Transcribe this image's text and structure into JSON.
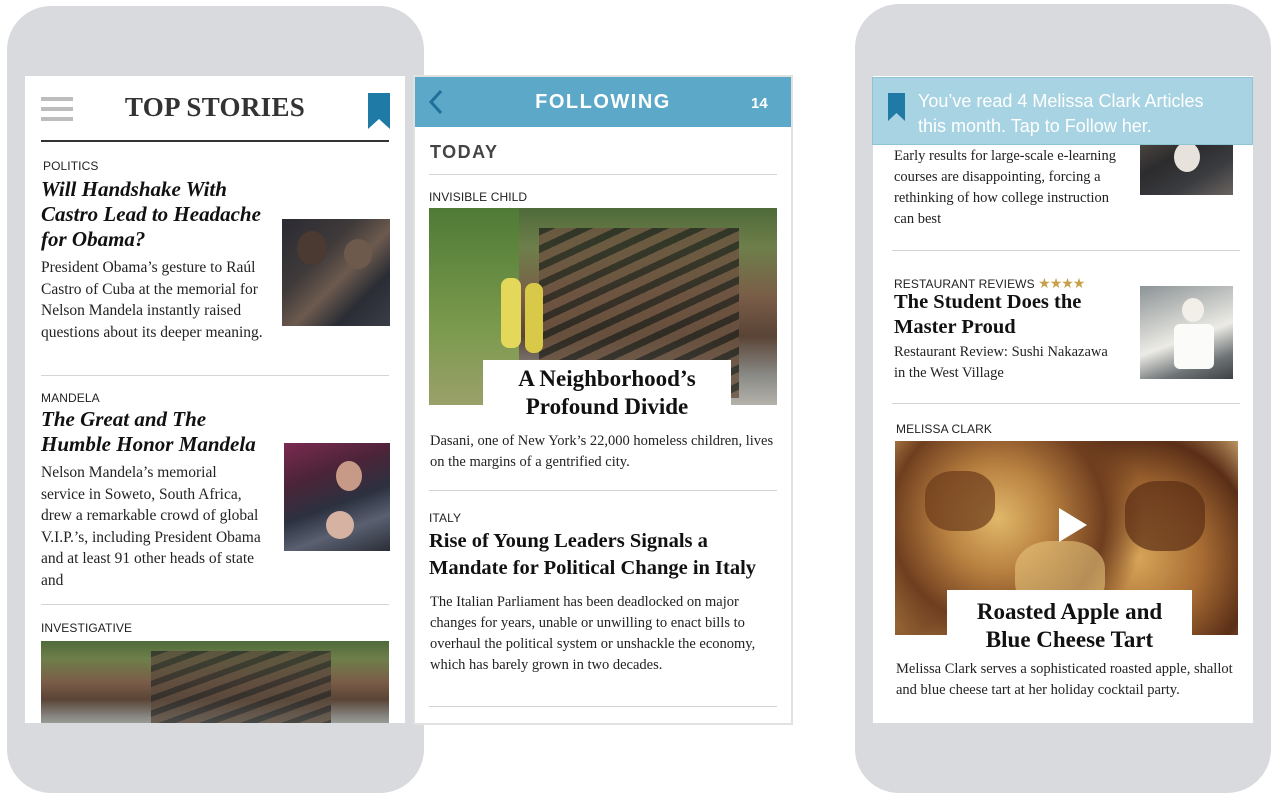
{
  "left_phone": {
    "header": {
      "title": "TOP STORIES",
      "menu_icon": "hamburger-menu-icon",
      "bookmark_icon": "bookmark-icon"
    },
    "stories": [
      {
        "section": "POLITICS",
        "headline": "Will Handshake With Castro Lead to Headache for Obama?",
        "summary": "President Obama’s gesture to Raúl Castro of Cuba at the memorial for Nelson Mandela instantly raised questions about its deeper meaning."
      },
      {
        "section": "MANDELA",
        "headline": "The Great and The Humble Honor Mandela",
        "summary": "Nelson Mandela’s memorial service in Soweto, South Africa, drew a remarkable crowd of global V.I.P.’s, including President Obama and at least 91 other heads of state and"
      },
      {
        "section": "INVESTIGATIVE"
      }
    ]
  },
  "middle_phone": {
    "header": {
      "back_icon": "chevron-left-icon",
      "title": "FOLLOWING",
      "count": "14",
      "bar_color": "#5ba8c8"
    },
    "date_heading": "TODAY",
    "stories": [
      {
        "section": "INVISIBLE CHILD",
        "headline_line1": "A Neighborhood’s",
        "headline_line2": "Profound Divide",
        "summary": "Dasani, one of New York’s 22,000 homeless children, lives on the margins of a gentrified city."
      },
      {
        "section": "ITALY",
        "headline": "Rise of Young Leaders Signals a Mandate for Political Change in Italy",
        "summary": "The Italian Parliament has been deadlocked on major changes for years, unable or unwilling to enact bills to overhaul the political system or unshackle the economy, which has barely grown in two decades."
      }
    ]
  },
  "right_phone": {
    "notification": {
      "icon": "bookmark-icon",
      "text_line1": "You’ve read 4 Melissa Clark Articles",
      "text_line2": "this month. Tap to Follow her.",
      "bg_color": "#a8d3e3"
    },
    "stories": [
      {
        "summary": "Early results for large-scale e-learning courses are disappointing, forcing a rethinking of how college instruction can best"
      },
      {
        "section": "RESTAURANT REVIEWS",
        "stars": "★★★★",
        "stars_color": "#c7a04a",
        "headline": "The Student Does the Master Proud",
        "summary": "Restaurant Review: Sushi Nakazawa in the West Village"
      },
      {
        "section": "MELISSA CLARK",
        "play_icon": "play-icon",
        "headline_line1": "Roasted Apple and",
        "headline_line2": "Blue Cheese Tart",
        "summary": "Melissa Clark serves a sophisticated roasted apple, shallot and blue cheese tart at her holiday cocktail party."
      }
    ]
  }
}
